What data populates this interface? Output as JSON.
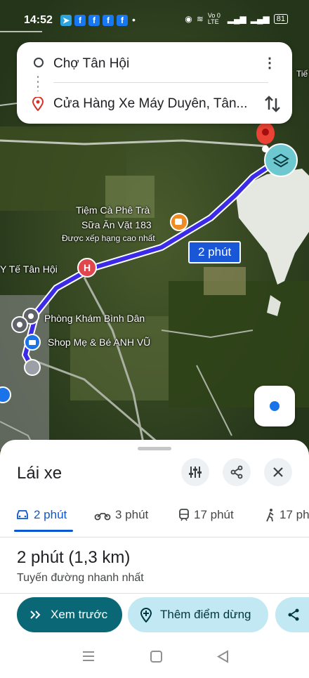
{
  "status_bar": {
    "time": "14:52",
    "notification_icons": [
      "telegram-icon",
      "facebook-icon",
      "facebook-icon",
      "facebook-icon",
      "facebook-icon"
    ],
    "network_label": "Vo 0 LTE",
    "battery": "81"
  },
  "search": {
    "origin": "Chợ Tân Hội",
    "destination": "Cửa Hàng Xe Máy Duyên, Tân..."
  },
  "map": {
    "route_duration_label": "2 phút",
    "places": [
      "Tiệm Cà Phê Trà",
      "Sữa Ăn Vặt 183",
      "Được xếp hạng cao nhất",
      "Y Tế Tân Hội",
      "Phòng Khám Bình Dân",
      "Shop Mẹ & Bé ANH VŨ",
      "Tiế"
    ],
    "route_color": "#3b2be8"
  },
  "sheet": {
    "mode_title": "Lái xe",
    "tabs": [
      {
        "icon": "car-icon",
        "label": "2 phút"
      },
      {
        "icon": "motorbike-icon",
        "label": "3 phút"
      },
      {
        "icon": "transit-icon",
        "label": "17 phút"
      },
      {
        "icon": "walk-icon",
        "label": "17 ph"
      }
    ],
    "summary": "2 phút (1,3 km)",
    "subtitle": "Tuyến đường nhanh nhất",
    "preview_button": "Xem trước",
    "add_stop_button": "Thêm điểm dừng"
  },
  "colors": {
    "accent": "#0b57d0",
    "primary_button": "#0a6876",
    "secondary_button": "#c2e9f3"
  }
}
